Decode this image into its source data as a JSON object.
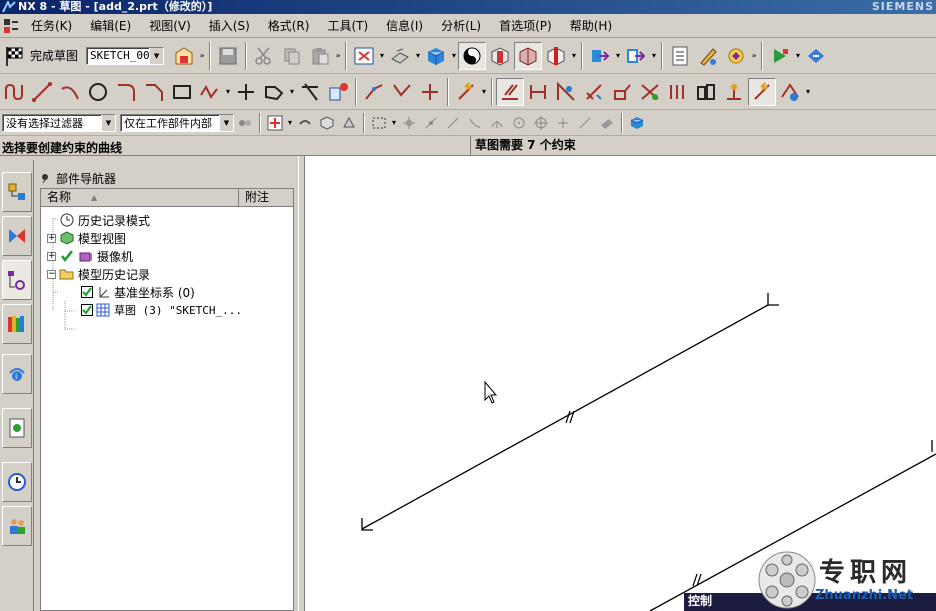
{
  "window": {
    "title": "NX 8 - 草图 - [add_2.prt（修改的）]",
    "brand": "SIEMENS"
  },
  "menu": [
    "任务(K)",
    "编辑(E)",
    "视图(V)",
    "插入(S)",
    "格式(R)",
    "工具(T)",
    "信息(I)",
    "分析(L)",
    "首选项(P)",
    "帮助(H)"
  ],
  "toolbar": {
    "finish_sketch_label": "完成草图",
    "sketch_name": "SKETCH_000"
  },
  "selection_bar": {
    "filter_value": "没有选择过滤器",
    "scope_value": "仅在工作部件内部"
  },
  "status": {
    "prompt": "选择要创建约束的曲线",
    "message": "草图需要 7 个约束"
  },
  "navigator": {
    "title": "部件导航器",
    "columns": [
      "名称",
      "附注"
    ],
    "nodes": [
      {
        "label": "历史记录模式"
      },
      {
        "label": "模型视图"
      },
      {
        "label": "摄像机"
      },
      {
        "label": "模型历史记录"
      },
      {
        "label": "基准坐标系 (0)"
      },
      {
        "label": "草图 (3) \"SKETCH_..."
      }
    ]
  },
  "control_panel": {
    "label": "控制"
  },
  "watermark": {
    "text": "专职网",
    "url": "Zhuanzhi.Net"
  }
}
